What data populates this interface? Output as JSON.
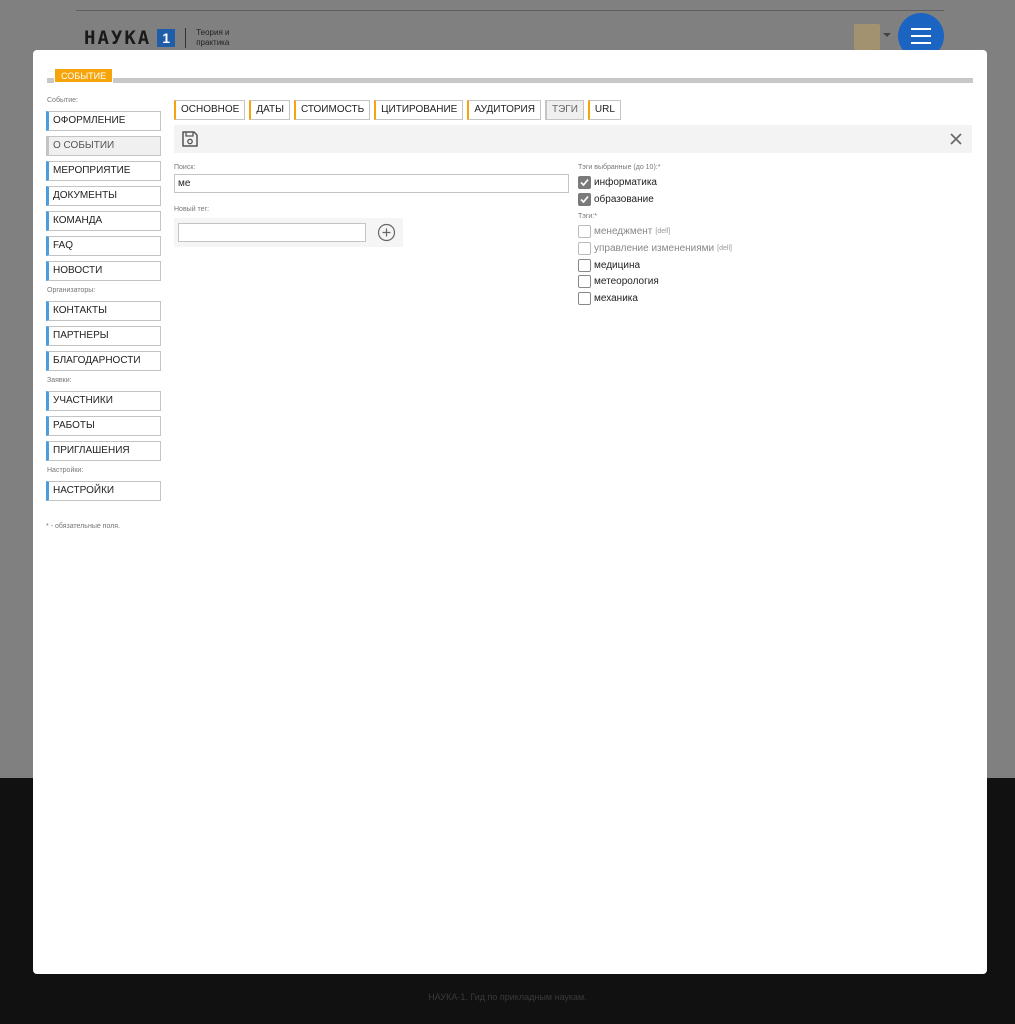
{
  "background": {
    "logo_word": "НАУКА",
    "logo_number": "1",
    "logo_subtitle": "Теория и практика",
    "footer_text": "НАУКА-1. Гид по прикладным наукам."
  },
  "modal": {
    "header_tab": "СОБЫТИЕ",
    "sidebar": {
      "section_event": "Событие:",
      "section_organizers": "Организаторы:",
      "section_requests": "Заявки:",
      "section_settings": "Настройки:",
      "items_event": [
        {
          "label": "ОФОРМЛЕНИЕ"
        },
        {
          "label": "О СОБЫТИИ"
        },
        {
          "label": "МЕРОПРИЯТИЕ"
        },
        {
          "label": "ДОКУМЕНТЫ"
        },
        {
          "label": "КОМАНДА"
        },
        {
          "label": "FAQ"
        },
        {
          "label": "НОВОСТИ"
        }
      ],
      "items_organizers": [
        {
          "label": "КОНТАКТЫ"
        },
        {
          "label": "ПАРТНЕРЫ"
        },
        {
          "label": "БЛАГОДАРНОСТИ"
        }
      ],
      "items_requests": [
        {
          "label": "УЧАСТНИКИ"
        },
        {
          "label": "РАБОТЫ"
        },
        {
          "label": "ПРИГЛАШЕНИЯ"
        }
      ],
      "items_settings": [
        {
          "label": "НАСТРОЙКИ"
        }
      ],
      "required_note": "* - обязательные поля."
    },
    "tabs": [
      {
        "label": "ОСНОВНОЕ"
      },
      {
        "label": "ДАТЫ"
      },
      {
        "label": "СТОИМОСТЬ"
      },
      {
        "label": "ЦИТИРОВАНИЕ"
      },
      {
        "label": "АУДИТОРИЯ"
      },
      {
        "label": "ТЭГИ"
      },
      {
        "label": "URL"
      }
    ],
    "active_tab": "ТЭГИ",
    "toolbar": {
      "save_icon": "save-icon",
      "close_icon": "close-icon"
    },
    "form": {
      "search_label": "Поиск:",
      "search_value": "ме",
      "new_tag_label": "Новый тег:",
      "new_tag_value": "",
      "add_icon": "plus-circle-icon",
      "selected_label": "Тэги выбранные (до 10):*",
      "selected_tags": [
        {
          "label": "информатика",
          "checked": true
        },
        {
          "label": "образование",
          "checked": true
        }
      ],
      "tags_label": "Тэги:*",
      "tags": [
        {
          "label": "менеджмент",
          "tag": "[dell]",
          "checked": false
        },
        {
          "label": "управление изменениями",
          "tag": "[dell]",
          "checked": false
        },
        {
          "label": "медицина",
          "tag": "",
          "checked": false
        },
        {
          "label": "метеорология",
          "tag": "",
          "checked": false
        },
        {
          "label": "механика",
          "tag": "",
          "checked": false
        }
      ]
    }
  }
}
